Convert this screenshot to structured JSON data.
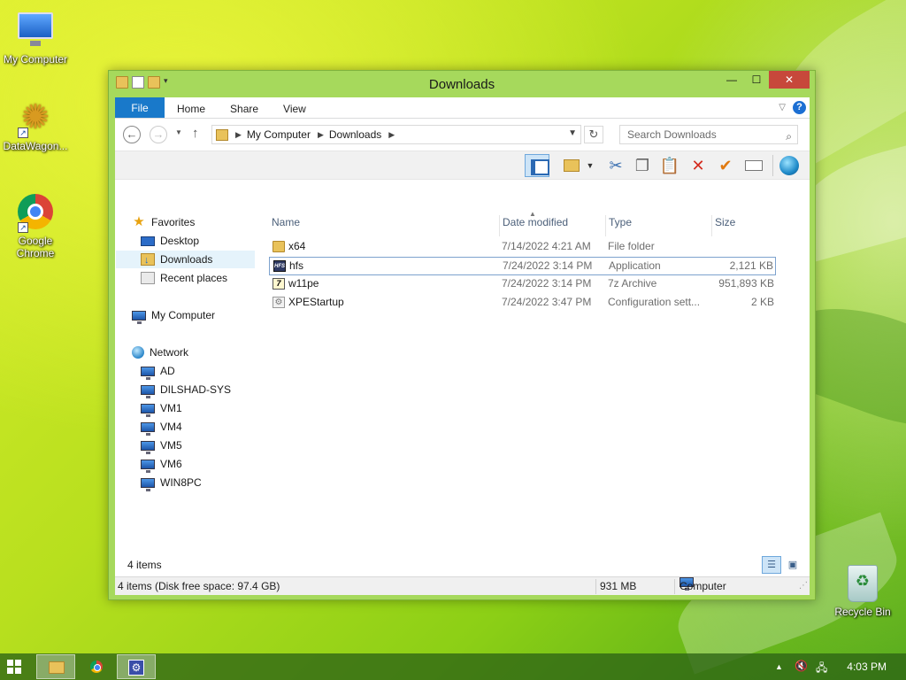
{
  "desktop": {
    "icons": [
      {
        "label": "My Computer"
      },
      {
        "label": "DataWagon..."
      },
      {
        "label": "Google Chrome"
      },
      {
        "label": "Recycle Bin"
      }
    ]
  },
  "window": {
    "title": "Downloads",
    "controls": {
      "minimize": "—",
      "maximize": "☐",
      "close": "✕"
    },
    "ribbon": {
      "file_tab": "File",
      "tabs": [
        "Home",
        "Share",
        "View"
      ]
    },
    "address": {
      "breadcrumbs": [
        "My Computer",
        "Downloads"
      ],
      "search_placeholder": "Search Downloads"
    },
    "nav": {
      "favorites": {
        "label": "Favorites",
        "items": [
          "Desktop",
          "Downloads",
          "Recent places"
        ],
        "selected": "Downloads"
      },
      "computer": "My Computer",
      "network": {
        "label": "Network",
        "items": [
          "AD",
          "DILSHAD-SYS",
          "VM1",
          "VM4",
          "VM5",
          "VM6",
          "WIN8PC"
        ]
      }
    },
    "columns": [
      "Name",
      "Date modified",
      "Type",
      "Size"
    ],
    "files": [
      {
        "name": "x64",
        "date": "7/14/2022 4:21 AM",
        "type": "File folder",
        "size": "",
        "icon": "folder-icon"
      },
      {
        "name": "hfs",
        "date": "7/24/2022 3:14 PM",
        "type": "Application",
        "size": "2,121 KB",
        "icon": "hfs-app-icon"
      },
      {
        "name": "w11pe",
        "date": "7/24/2022 3:14 PM",
        "type": "7z Archive",
        "size": "951,893 KB",
        "icon": "archive-icon"
      },
      {
        "name": "XPEStartup",
        "date": "7/24/2022 3:47 PM",
        "type": "Configuration sett...",
        "size": "2 KB",
        "icon": "config-file-icon"
      }
    ],
    "item_count": "4 items",
    "status": {
      "left": "4 items (Disk free space: 97.4 GB)",
      "size": "931 MB",
      "location": "Computer"
    }
  },
  "taskbar": {
    "clock": "4:03 PM"
  }
}
